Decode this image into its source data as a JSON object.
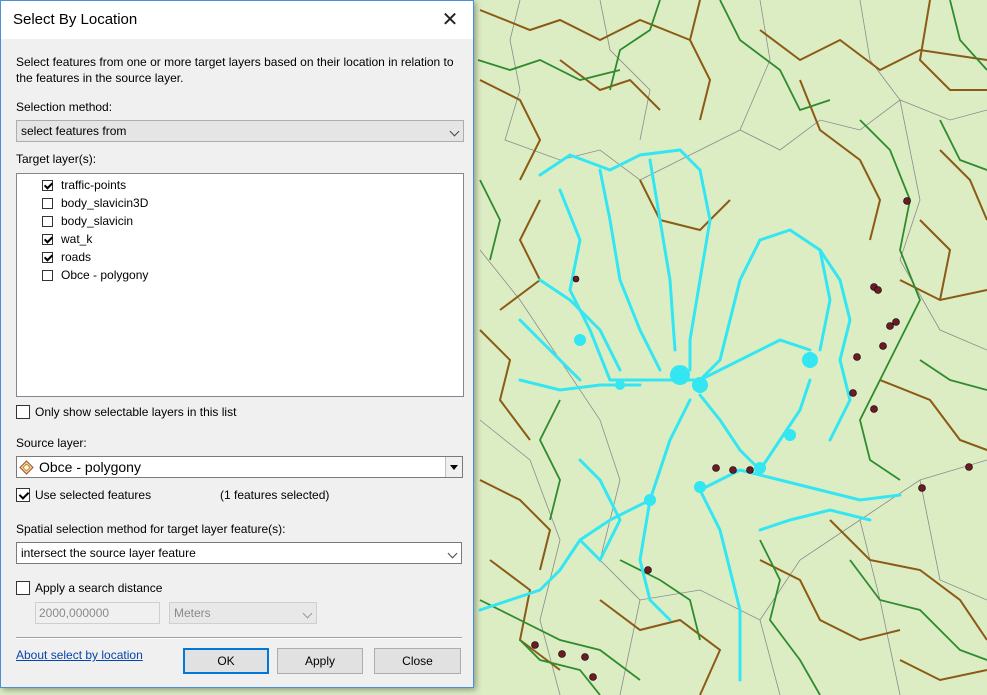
{
  "dialog": {
    "title": "Select By Location",
    "description": "Select features from one or more target layers based on their location in relation to the features in the source layer.",
    "selection_method_label": "Selection method:",
    "selection_method_value": "select features from",
    "target_layers_label": "Target layer(s):",
    "target_layers": [
      {
        "name": "traffic-points",
        "checked": true
      },
      {
        "name": "body_slavicin3D",
        "checked": false
      },
      {
        "name": "body_slavicin",
        "checked": false
      },
      {
        "name": "wat_k",
        "checked": true
      },
      {
        "name": "roads",
        "checked": true
      },
      {
        "name": "Obce - polygony",
        "checked": false
      }
    ],
    "only_selectable_label": "Only show selectable layers in this list",
    "only_selectable_checked": false,
    "source_layer_label": "Source layer:",
    "source_layer_value": "Obce - polygony",
    "use_selected_label": "Use selected features",
    "use_selected_checked": true,
    "features_selected_text": "(1 features selected)",
    "spatial_method_label": "Spatial selection method for target layer feature(s):",
    "spatial_method_value": "intersect the source layer feature",
    "apply_distance_label": "Apply a search distance",
    "apply_distance_checked": false,
    "distance_value": "2000,000000",
    "distance_unit": "Meters",
    "about_link": "About select by location",
    "ok_label": "OK",
    "apply_label": "Apply",
    "close_label": "Close"
  },
  "map": {
    "background_color": "#dcedc4",
    "polygon_fill_color": "#d7eac1",
    "river_color": "#2e8b2e",
    "road_color": "#8b5a14",
    "boundary_color": "#8c8c8c",
    "selected_color": "#33e6f2",
    "point_color": "#6b1a26"
  }
}
